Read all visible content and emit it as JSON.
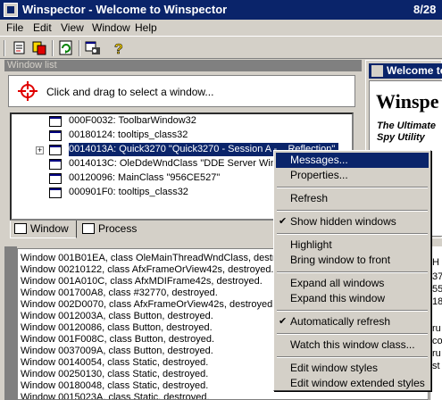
{
  "window": {
    "title": "Winspector - Welcome to Winspector",
    "clock": "8/28"
  },
  "menu": [
    "File",
    "Edit",
    "View",
    "Window",
    "Help"
  ],
  "toolbar": {
    "icons": [
      "window-finder-icon",
      "copy-icon",
      "refresh-icon",
      "spy-icon",
      "help-icon"
    ]
  },
  "window_list": {
    "header": "Window list",
    "drag_text": "Click and drag to select a window...",
    "items": [
      "000F0032: ToolbarWindow32",
      "00180124: tooltips_class32",
      "0014013A: Quick3270  \"Quick3270 - Session A - ...Reflection\"",
      "0014013C: OleDdeWndClass  \"DDE Server Window\"",
      "00120096: MainClass  \"956CE527\"",
      "000901F0: tooltips_class32"
    ],
    "tabs": [
      "Window",
      "Process"
    ]
  },
  "welcome": {
    "title": "Welcome to Winspector",
    "heading": "Winspe",
    "subtitle_line1": "The Ultimate",
    "subtitle_line2": "Spy Utility"
  },
  "log": [
    "Window 001B01EA, class OleMainThreadWndClass, destroyed.",
    "Window 00210122, class AfxFrameOrView42s, destroyed.",
    "Window 001A010C, class AfxMDIFrame42s, destroyed.",
    "Window 001700A8, class #32770, destroyed.",
    "Window 002D0070, class AfxFrameOrView42s, destroyed.",
    "Window 0012003A, class Button, destroyed.",
    "Window 00120086, class Button, destroyed.",
    "Window 001F008C, class Button, destroyed.",
    "Window 0037009A, class Button, destroyed.",
    "Window 00140054, class Static, destroyed.",
    "Window 00250130, class Static, destroyed.",
    "Window 00180048, class Static, destroyed.",
    "Window 0015023A, class Static, destroyed."
  ],
  "right_log": [
    "H",
    "37",
    "55",
    "18",
    "",
    "ru",
    "co",
    "ru",
    "st"
  ],
  "context_menu": {
    "groups": [
      [
        {
          "label": "Messages...",
          "highlighted": true
        },
        {
          "label": "Properties..."
        }
      ],
      [
        {
          "label": "Refresh"
        }
      ],
      [
        {
          "label": "Show hidden windows",
          "checked": true
        }
      ],
      [
        {
          "label": "Highlight"
        },
        {
          "label": "Bring window to front"
        }
      ],
      [
        {
          "label": "Expand all windows"
        },
        {
          "label": "Expand this window"
        }
      ],
      [
        {
          "label": "Automatically refresh",
          "checked": true
        }
      ],
      [
        {
          "label": "Watch this window class..."
        }
      ],
      [
        {
          "label": "Edit window styles"
        },
        {
          "label": "Edit window extended styles"
        }
      ]
    ]
  },
  "colors": {
    "face": "#d4d0c8",
    "title_bar": "#0a246a",
    "selection": "#0a246a"
  }
}
